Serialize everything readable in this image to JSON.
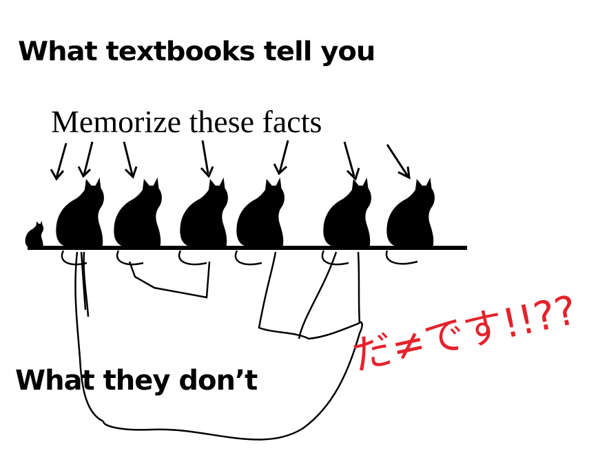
{
  "texts": {
    "top_title": "What textbooks tell you",
    "subtitle": "Memorize these facts",
    "bottom_title": "What they don’t",
    "red_annotation": "だ≠です!!??"
  },
  "colors": {
    "ink": "#000000",
    "annotation": "#e4222b",
    "background": "#ffffff"
  }
}
